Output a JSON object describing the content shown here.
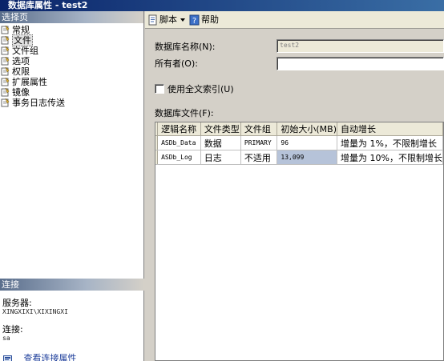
{
  "window": {
    "title": "数据库属性 - test2"
  },
  "sidebar": {
    "header": "选择页",
    "items": [
      {
        "label": "常规",
        "icon": "page-icon",
        "selected": false
      },
      {
        "label": "文件",
        "icon": "page-icon",
        "selected": true
      },
      {
        "label": "文件组",
        "icon": "page-icon",
        "selected": false
      },
      {
        "label": "选项",
        "icon": "page-icon",
        "selected": false
      },
      {
        "label": "权限",
        "icon": "page-icon",
        "selected": false
      },
      {
        "label": "扩展属性",
        "icon": "page-icon",
        "selected": false
      },
      {
        "label": "镜像",
        "icon": "page-icon",
        "selected": false
      },
      {
        "label": "事务日志传送",
        "icon": "page-icon",
        "selected": false
      }
    ]
  },
  "connection": {
    "header": "连接",
    "server_label": "服务器:",
    "server_value": "XINGXIXI\\XIXINGXI",
    "conn_label": "连接:",
    "conn_value": "sa",
    "link_label": "查看连接属性"
  },
  "toolbar": {
    "script_label": "脚本",
    "help_label": "帮助"
  },
  "form": {
    "dbname_label": "数据库名称(N):",
    "dbname_value": "test2",
    "owner_label": "所有者(O):",
    "owner_value": "",
    "fulltext_label": "使用全文索引(U)",
    "files_label": "数据库文件(F):"
  },
  "files_table": {
    "columns": [
      "逻辑名称",
      "文件类型",
      "文件组",
      "初始大小(MB)",
      "自动增长"
    ],
    "rows": [
      {
        "logical": "ASDb_Data",
        "type": "数据",
        "group": "PRIMARY",
        "size": "96",
        "growth": "增量为 1%，不限制增长"
      },
      {
        "logical": "ASDb_Log",
        "type": "日志",
        "group": "不适用",
        "size": "13,099",
        "growth": "增量为 10%，不限制增长"
      }
    ]
  },
  "colors": {
    "title_bar": "#0a246a",
    "selected_cell": "#b6c3d9",
    "link": "#1b3c9a"
  }
}
